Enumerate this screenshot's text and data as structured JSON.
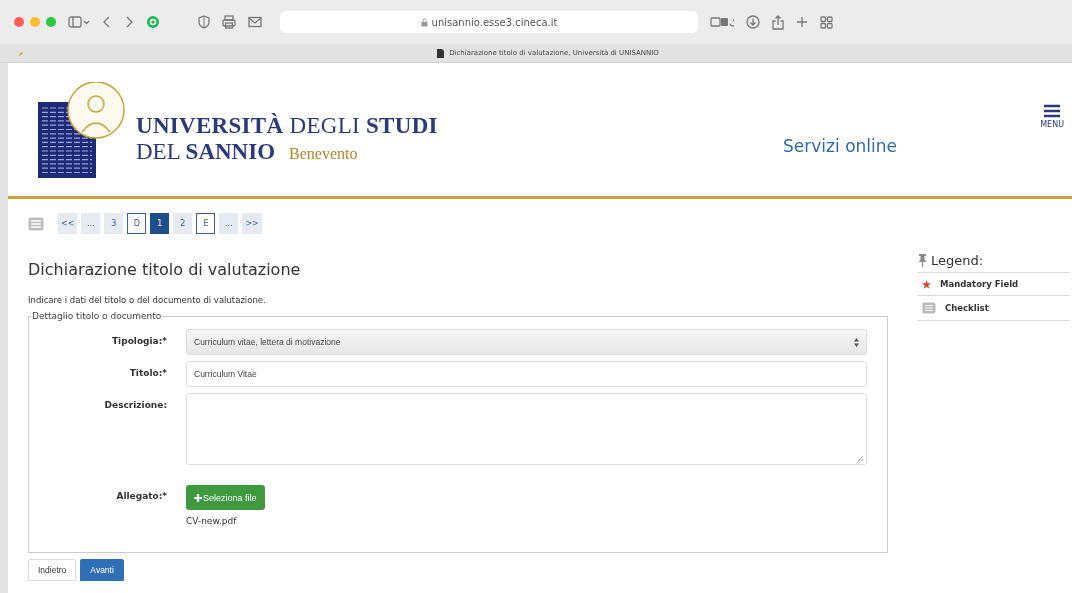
{
  "browser": {
    "url": "unisannio.esse3.cineca.it",
    "tab_title": "Dichiarazione titolo di valutazione, Università di UNISANNIO"
  },
  "header": {
    "logo_line_1": "**UNIVERSITÀ** DEGLI **STUDI**",
    "logo_line_2": "DEL **SANNIO**",
    "logo_city": "Benevento",
    "services_link": "Servizi online",
    "menu_label": "MENU"
  },
  "steps": [
    {
      "label": "<<",
      "kind": "nav",
      "selected": false
    },
    {
      "label": "...",
      "kind": "nav",
      "selected": false
    },
    {
      "label": "3",
      "kind": "page",
      "selected": false
    },
    {
      "label": "D",
      "kind": "step",
      "selected": false
    },
    {
      "label": "1",
      "kind": "page",
      "selected": true
    },
    {
      "label": "2",
      "kind": "page",
      "selected": false
    },
    {
      "label": "E",
      "kind": "step",
      "selected": false
    },
    {
      "label": "...",
      "kind": "nav",
      "selected": false
    },
    {
      "label": ">>",
      "kind": "nav",
      "selected": false
    }
  ],
  "page_title": "Dichiarazione titolo di valutazione",
  "instructions": "Indicare i dati del titolo o del documento di valutazione.",
  "fieldset": {
    "legend": "Dettaglio titolo o documento",
    "fields": [
      {
        "label": "Tipologia:*",
        "kind": "select",
        "value": "Curriculum vitae, lettera di motivazione"
      },
      {
        "label": "Titolo:*",
        "kind": "input",
        "value": "Curriculum Vitae"
      },
      {
        "label": "Descrizione:",
        "kind": "textarea"
      },
      {
        "label": "Allegato:*",
        "kind": "file",
        "button": "Seleziona file",
        "file_name": "CV-new.pdf"
      }
    ]
  },
  "buttons": [
    {
      "label": "Indietro",
      "kind": "secondary"
    },
    {
      "label": "Avanti",
      "kind": "primary"
    }
  ],
  "legend": {
    "title": "Legend:",
    "items": [
      {
        "label": "Mandatory Field",
        "kind": "star"
      },
      {
        "label": "Checklist",
        "kind": "list"
      }
    ]
  }
}
